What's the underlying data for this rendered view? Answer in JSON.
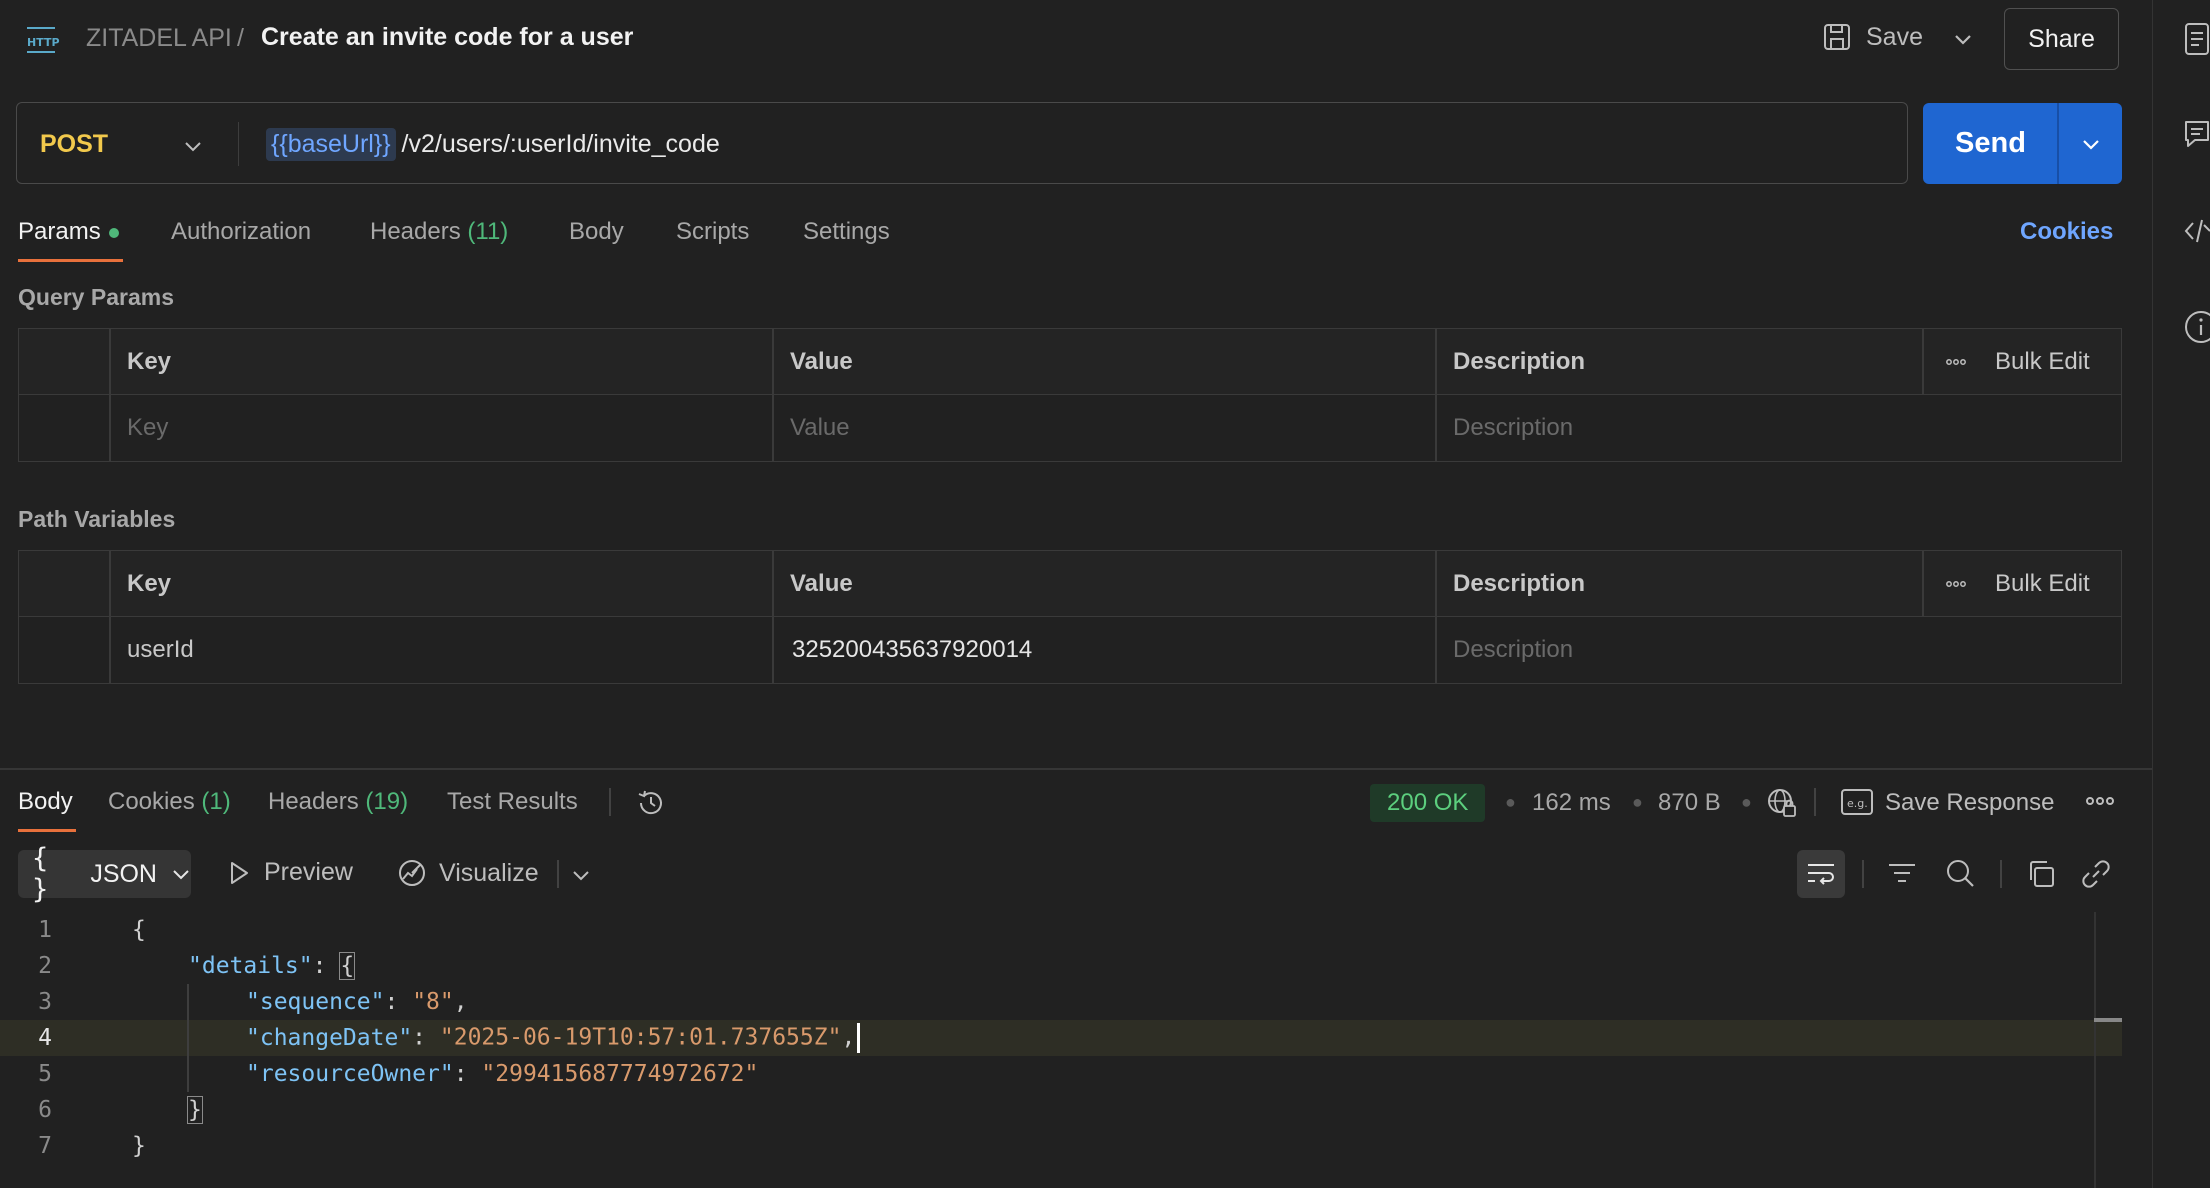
{
  "header": {
    "collection": "ZITADEL API",
    "separator": "/",
    "title": "Create an invite code for a user",
    "save_label": "Save",
    "share_label": "Share"
  },
  "request": {
    "method": "POST",
    "url_variable": "{{baseUrl}}",
    "url_path": "/v2/users/:userId/invite_code",
    "send_label": "Send"
  },
  "request_tabs": {
    "params": "Params",
    "authorization": "Authorization",
    "headers": "Headers",
    "headers_count": "(11)",
    "body": "Body",
    "scripts": "Scripts",
    "settings": "Settings",
    "cookies": "Cookies"
  },
  "query_params": {
    "title": "Query Params",
    "headers": {
      "key": "Key",
      "value": "Value",
      "description": "Description",
      "bulk_edit": "Bulk Edit"
    },
    "placeholder": {
      "key": "Key",
      "value": "Value",
      "description": "Description"
    }
  },
  "path_variables": {
    "title": "Path Variables",
    "headers": {
      "key": "Key",
      "value": "Value",
      "description": "Description",
      "bulk_edit": "Bulk Edit"
    },
    "rows": [
      {
        "key": "userId",
        "value": "325200435637920014",
        "description_placeholder": "Description"
      }
    ]
  },
  "response": {
    "tabs": {
      "body": "Body",
      "cookies": "Cookies",
      "cookies_count": "(1)",
      "headers": "Headers",
      "headers_count": "(19)",
      "test_results": "Test Results"
    },
    "status": "200 OK",
    "time": "162 ms",
    "size": "870 B",
    "save_response": "Save Response",
    "format": "JSON",
    "preview": "Preview",
    "visualize": "Visualize",
    "code_lines": [
      {
        "n": "1",
        "text": "{"
      },
      {
        "n": "2",
        "key": "\"details\"",
        "after": ": {"
      },
      {
        "n": "3",
        "key": "\"sequence\"",
        "value": "\"8\"",
        "after": ","
      },
      {
        "n": "4",
        "key": "\"changeDate\"",
        "value": "\"2025-06-19T10:57:01.737655Z\"",
        "after": ","
      },
      {
        "n": "5",
        "key": "\"resourceOwner\"",
        "value": "\"299415687774972672\""
      },
      {
        "n": "6",
        "text": "}"
      },
      {
        "n": "7",
        "text": "}"
      }
    ]
  },
  "colors": {
    "accent": "#e8713c",
    "send": "#1f66d1",
    "method": "#f2c94c",
    "status_ok": "#5ccf7e",
    "link": "#6fa6ff"
  },
  "icons": [
    "http-icon",
    "save-icon",
    "chevron-down-icon",
    "globe-lock-icon",
    "example-icon",
    "more-icon",
    "history-icon",
    "braces-icon",
    "play-icon",
    "visualize-icon",
    "wrap-icon",
    "filter-icon",
    "search-icon",
    "copy-icon",
    "link-icon",
    "docs-icon",
    "comment-icon",
    "code-icon",
    "info-icon"
  ]
}
